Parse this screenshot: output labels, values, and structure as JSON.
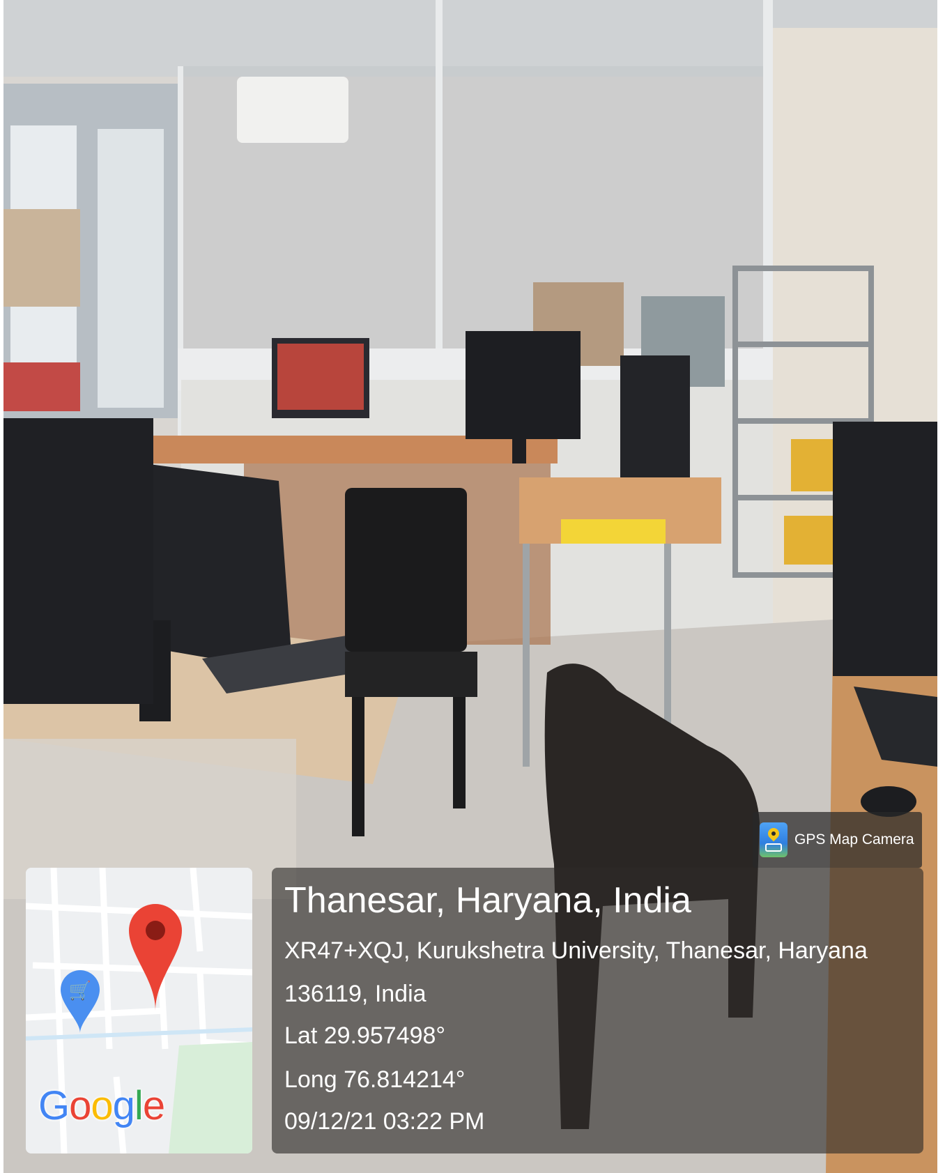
{
  "badge": {
    "label": "GPS Map Camera",
    "icon": "gps-map-camera-app-icon"
  },
  "location": {
    "title": "Thanesar, Haryana, India",
    "address_line_1": "XR47+XQJ, Kurukshetra University, Thanesar, Haryana",
    "address_line_2": "136119, India",
    "latitude": "Lat 29.957498°",
    "longitude": "Long 76.814214°",
    "datetime": "09/12/21 03:22 PM"
  },
  "map": {
    "brand": [
      "G",
      "o",
      "o",
      "g",
      "l",
      "e"
    ],
    "pin_icon": "location-pin-icon",
    "poi_icon": "shopping-cart-icon"
  },
  "colors": {
    "pin_red": "#ea4335",
    "poi_blue": "#4a8ff0",
    "overlay": "#2d2a28"
  }
}
